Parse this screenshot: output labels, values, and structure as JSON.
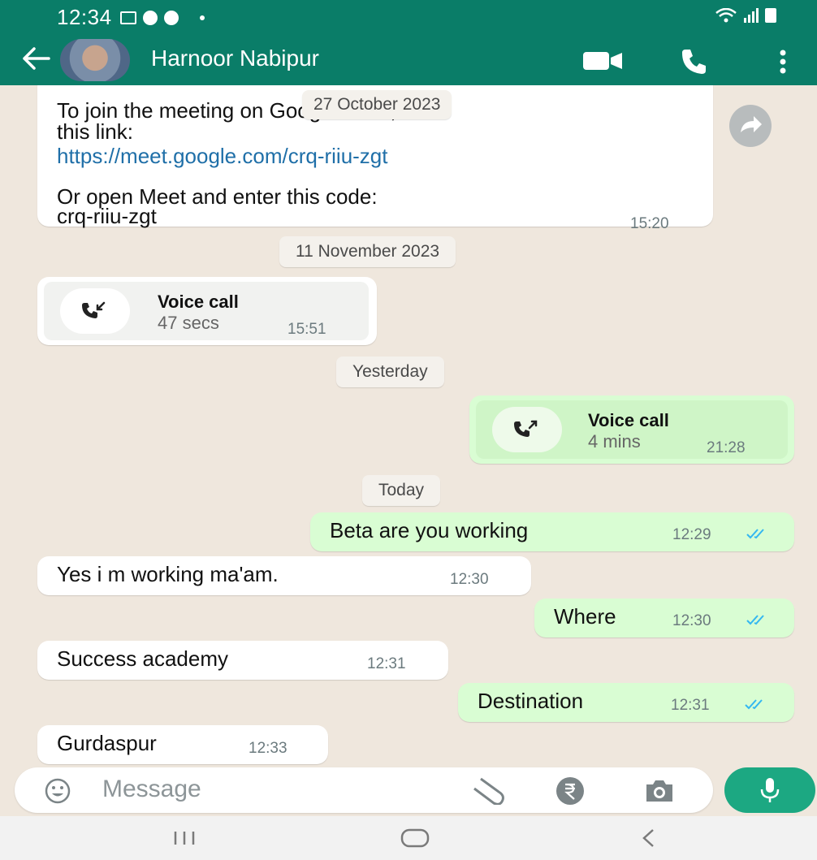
{
  "status_bar": {
    "time": "12:34"
  },
  "header": {
    "contact_name": "Harnoor Nabipur",
    "icons": [
      "back-arrow-icon",
      "video-call-icon",
      "voice-call-icon",
      "more-options-icon"
    ]
  },
  "messages": {
    "link_message": {
      "line1": "To join the meeting on Google Meet, click",
      "line2": "this link:",
      "link": "https://meet.google.com/crq-riiu-zgt",
      "line3": "Or open Meet and enter this code:",
      "line4": "crq-riiu-zgt",
      "time": "15:20",
      "date_overlay": "27 October 2023"
    },
    "date_nov": "11 November 2023",
    "call_in": {
      "title": "Voice call",
      "duration": "47 secs",
      "time": "15:51"
    },
    "date_yesterday": "Yesterday",
    "call_out": {
      "title": "Voice call",
      "duration": "4 mins",
      "time": "21:28"
    },
    "date_today": "Today",
    "m1": {
      "text": "Beta are you working",
      "time": "12:29"
    },
    "m2": {
      "text": "Yes i m working ma'am.",
      "time": "12:30"
    },
    "m3": {
      "text": "Where",
      "time": "12:30"
    },
    "m4": {
      "text": "Success academy",
      "time": "12:31"
    },
    "m5": {
      "text": "Destination",
      "time": "12:31"
    },
    "m6": {
      "text": "Gurdaspur",
      "time": "12:33"
    }
  },
  "input": {
    "placeholder": "Message"
  },
  "colors": {
    "header": "#0a7d68",
    "outgoing": "#d9fdd3",
    "incoming": "#ffffff",
    "tick": "#34b7f1",
    "mic": "#1ca882",
    "chat_bg": "#efe7dd"
  }
}
